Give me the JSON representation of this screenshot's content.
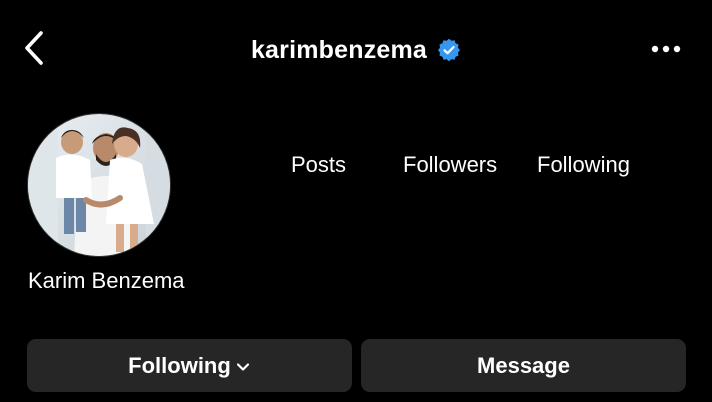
{
  "header": {
    "username": "karimbenzema",
    "verified": true,
    "verified_color": "#3797F0"
  },
  "profile": {
    "display_name": "Karim Benzema",
    "avatar": "profile-photo"
  },
  "stats": {
    "posts_label": "Posts",
    "followers_label": "Followers",
    "following_label": "Following"
  },
  "actions": {
    "following_label": "Following",
    "message_label": "Message"
  },
  "icons": {
    "back": "chevron-left-icon",
    "more": "more-horizontal-icon",
    "dropdown": "chevron-down-icon"
  },
  "colors": {
    "background": "#000000",
    "button": "#262626",
    "text": "#FFFFFF"
  }
}
